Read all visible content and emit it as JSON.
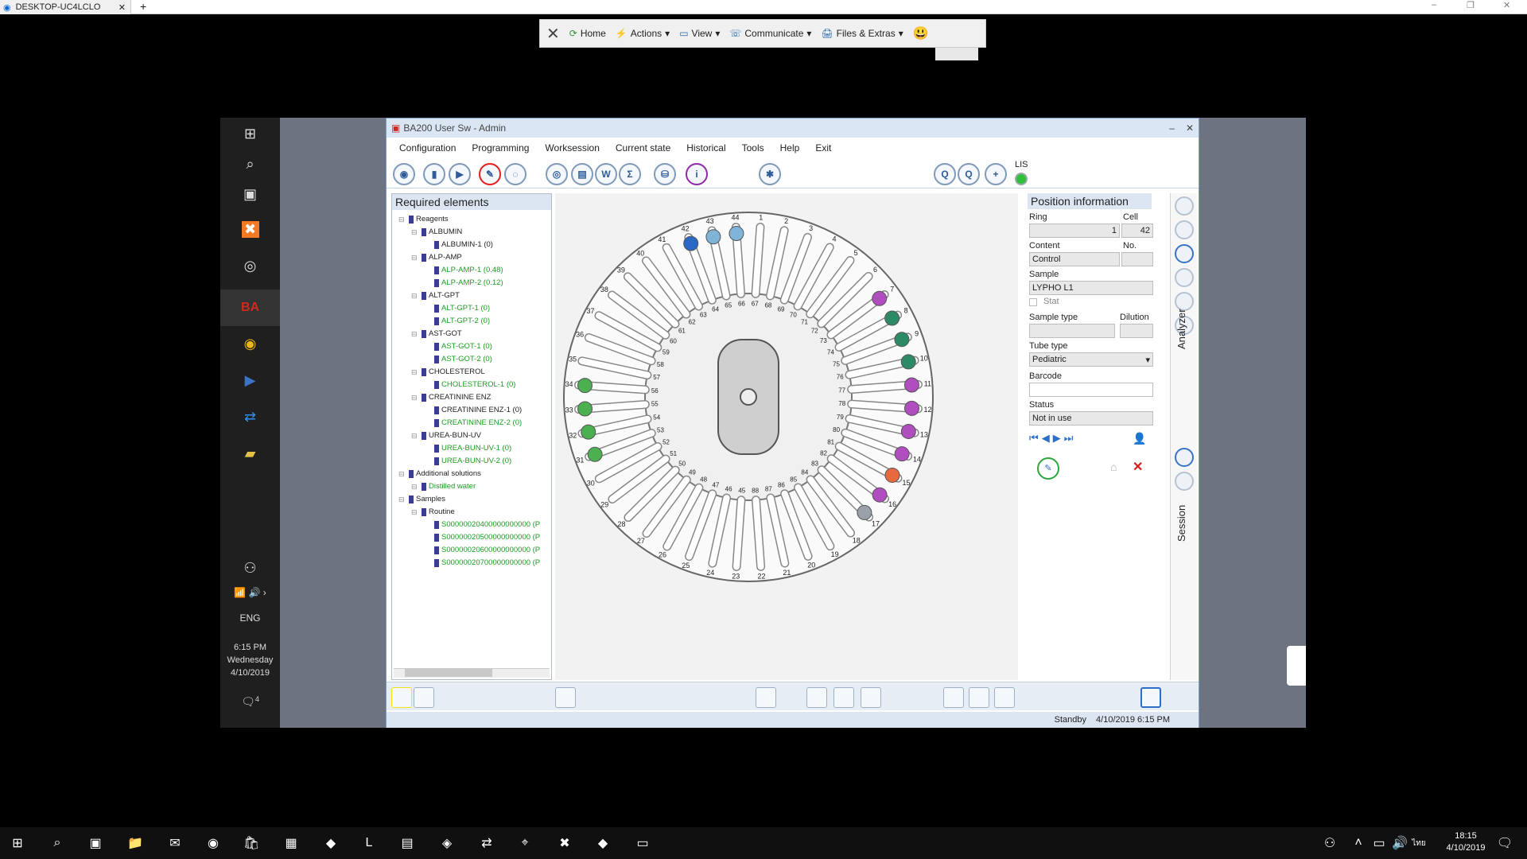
{
  "browser": {
    "tab_title": "DESKTOP-UC4LCLO",
    "close": "✕",
    "new_tab": "+"
  },
  "teamviewer_toolbar": {
    "close": "✕",
    "items": [
      {
        "label": "Home",
        "icon": "home-icon"
      },
      {
        "label": "Actions",
        "icon": "actions-icon"
      },
      {
        "label": "View",
        "icon": "view-icon"
      },
      {
        "label": "Communicate",
        "icon": "communicate-icon"
      },
      {
        "label": "Files & Extras",
        "icon": "files-icon"
      }
    ],
    "smiley": "😃"
  },
  "remote_sidebar": {
    "lang": "ENG",
    "time": "6:15 PM",
    "day": "Wednesday",
    "date": "4/10/2019",
    "notif_count": "4"
  },
  "app": {
    "title": "BA200 User Sw - Admin",
    "window_min": "–",
    "window_close": "✕",
    "menu": [
      "Configuration",
      "Programming",
      "Worksession",
      "Current state",
      "Historical",
      "Tools",
      "Help",
      "Exit"
    ],
    "lis_label": "LIS",
    "required_elements_title": "Required elements",
    "tree": [
      {
        "level": 0,
        "label": "Reagents",
        "green": false
      },
      {
        "level": 1,
        "label": "ALBUMIN",
        "green": false
      },
      {
        "level": 2,
        "label": "ALBUMIN-1 (0)",
        "green": false
      },
      {
        "level": 1,
        "label": "ALP-AMP",
        "green": false
      },
      {
        "level": 2,
        "label": "ALP-AMP-1 (0.48)",
        "green": true
      },
      {
        "level": 2,
        "label": "ALP-AMP-2 (0.12)",
        "green": true
      },
      {
        "level": 1,
        "label": "ALT-GPT",
        "green": false
      },
      {
        "level": 2,
        "label": "ALT-GPT-1 (0)",
        "green": true
      },
      {
        "level": 2,
        "label": "ALT-GPT-2 (0)",
        "green": true
      },
      {
        "level": 1,
        "label": "AST-GOT",
        "green": false
      },
      {
        "level": 2,
        "label": "AST-GOT-1 (0)",
        "green": true
      },
      {
        "level": 2,
        "label": "AST-GOT-2 (0)",
        "green": true
      },
      {
        "level": 1,
        "label": "CHOLESTEROL",
        "green": false
      },
      {
        "level": 2,
        "label": "CHOLESTEROL-1 (0)",
        "green": true
      },
      {
        "level": 1,
        "label": "CREATININE ENZ",
        "green": false
      },
      {
        "level": 2,
        "label": "CREATININE ENZ-1 (0)",
        "green": false
      },
      {
        "level": 2,
        "label": "CREATININE ENZ-2 (0)",
        "green": true
      },
      {
        "level": 1,
        "label": "UREA-BUN-UV",
        "green": false
      },
      {
        "level": 2,
        "label": "UREA-BUN-UV-1 (0)",
        "green": true
      },
      {
        "level": 2,
        "label": "UREA-BUN-UV-2 (0)",
        "green": true
      },
      {
        "level": 0,
        "label": "Additional solutions",
        "green": false
      },
      {
        "level": 1,
        "label": "Distilled water",
        "green": true
      },
      {
        "level": 0,
        "label": "Samples",
        "green": false
      },
      {
        "level": 1,
        "label": "Routine",
        "green": false
      },
      {
        "level": 2,
        "label": "S00000020400000000000 (P",
        "green": true
      },
      {
        "level": 2,
        "label": "S00000020500000000000 (P",
        "green": true
      },
      {
        "level": 2,
        "label": "S00000020600000000000 (P",
        "green": true
      },
      {
        "level": 2,
        "label": "S00000020700000000000 (P",
        "green": true
      }
    ],
    "position_info": {
      "title": "Position information",
      "ring_label": "Ring",
      "ring_value": "1",
      "cell_label": "Cell",
      "cell_value": "42",
      "content_label": "Content",
      "content_value": "Control",
      "no_label": "No.",
      "no_value": "",
      "sample_label": "Sample",
      "sample_value": "LYPHO L1",
      "stat_label": "Stat",
      "sample_type_label": "Sample type",
      "sample_type_value": "",
      "dilution_label": "Dilution",
      "dilution_value": "",
      "tube_type_label": "Tube type",
      "tube_type_value": "Pediatric",
      "barcode_label": "Barcode",
      "barcode_value": "",
      "status_label": "Status",
      "status_value": "Not in use"
    },
    "vertical_tabs": {
      "analyzer": "Analyzer",
      "session": "Session"
    },
    "status_bar": {
      "state": "Standby",
      "datetime": "4/10/2019 6:15 PM"
    },
    "rotor": {
      "outer_numbers": [
        "1",
        "2",
        "3",
        "4",
        "5",
        "6",
        "7",
        "8",
        "9",
        "10",
        "11",
        "12",
        "13",
        "14",
        "15",
        "16",
        "17",
        "18",
        "19",
        "20",
        "21",
        "22",
        "23",
        "24",
        "25",
        "26",
        "27",
        "28",
        "29",
        "30",
        "31",
        "32",
        "33",
        "34",
        "35",
        "36",
        "37",
        "38",
        "39",
        "40",
        "41",
        "42",
        "43",
        "44"
      ],
      "inner_numbers": [
        "45",
        "46",
        "47",
        "48",
        "49",
        "50",
        "51",
        "52",
        "53",
        "54",
        "55",
        "56",
        "57",
        "58",
        "59",
        "60",
        "61",
        "62",
        "63",
        "64",
        "65",
        "66",
        "67",
        "68",
        "69",
        "70",
        "71",
        "72",
        "73",
        "74",
        "75",
        "76",
        "77",
        "78",
        "79",
        "80",
        "81",
        "82",
        "83",
        "84",
        "85",
        "86",
        "87",
        "88"
      ]
    }
  },
  "taskbar": {
    "time": "18:15",
    "date": "4/10/2019",
    "lang": "ไทย"
  }
}
